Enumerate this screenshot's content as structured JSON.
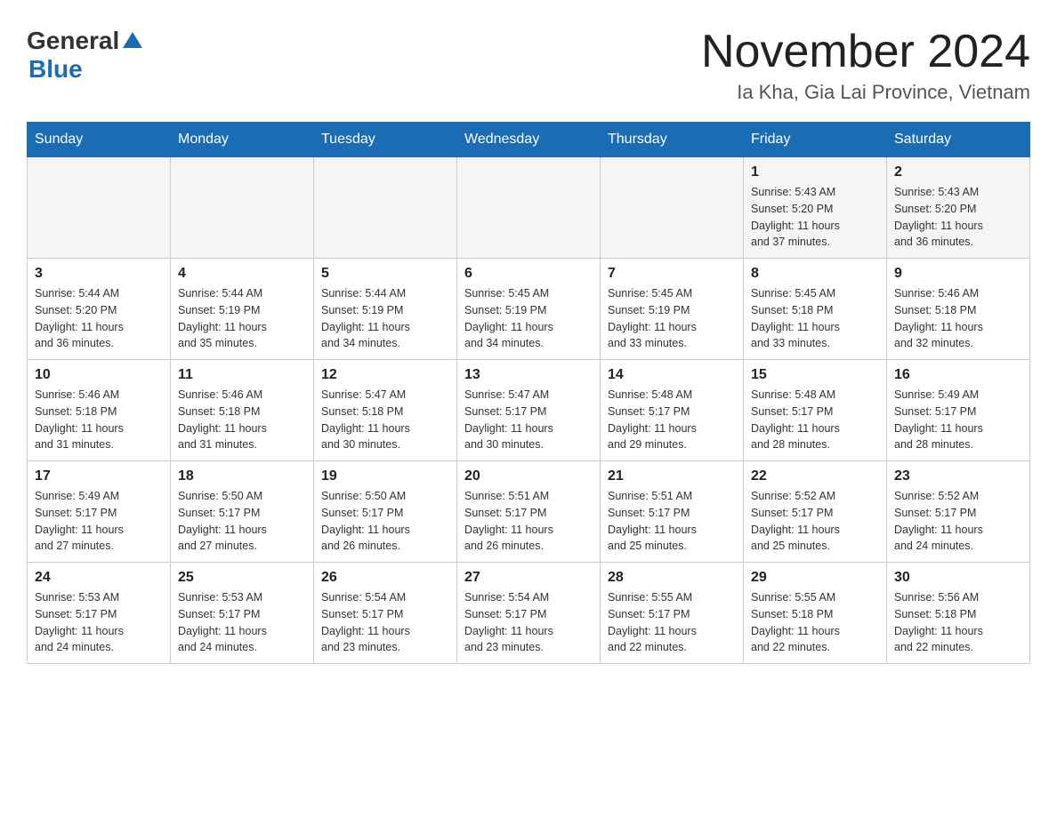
{
  "header": {
    "logo_general": "General",
    "logo_arrow": "▲",
    "logo_blue": "Blue",
    "title": "November 2024",
    "subtitle": "Ia Kha, Gia Lai Province, Vietnam"
  },
  "weekdays": [
    "Sunday",
    "Monday",
    "Tuesday",
    "Wednesday",
    "Thursday",
    "Friday",
    "Saturday"
  ],
  "weeks": [
    [
      {
        "day": "",
        "info": ""
      },
      {
        "day": "",
        "info": ""
      },
      {
        "day": "",
        "info": ""
      },
      {
        "day": "",
        "info": ""
      },
      {
        "day": "",
        "info": ""
      },
      {
        "day": "1",
        "info": "Sunrise: 5:43 AM\nSunset: 5:20 PM\nDaylight: 11 hours\nand 37 minutes."
      },
      {
        "day": "2",
        "info": "Sunrise: 5:43 AM\nSunset: 5:20 PM\nDaylight: 11 hours\nand 36 minutes."
      }
    ],
    [
      {
        "day": "3",
        "info": "Sunrise: 5:44 AM\nSunset: 5:20 PM\nDaylight: 11 hours\nand 36 minutes."
      },
      {
        "day": "4",
        "info": "Sunrise: 5:44 AM\nSunset: 5:19 PM\nDaylight: 11 hours\nand 35 minutes."
      },
      {
        "day": "5",
        "info": "Sunrise: 5:44 AM\nSunset: 5:19 PM\nDaylight: 11 hours\nand 34 minutes."
      },
      {
        "day": "6",
        "info": "Sunrise: 5:45 AM\nSunset: 5:19 PM\nDaylight: 11 hours\nand 34 minutes."
      },
      {
        "day": "7",
        "info": "Sunrise: 5:45 AM\nSunset: 5:19 PM\nDaylight: 11 hours\nand 33 minutes."
      },
      {
        "day": "8",
        "info": "Sunrise: 5:45 AM\nSunset: 5:18 PM\nDaylight: 11 hours\nand 33 minutes."
      },
      {
        "day": "9",
        "info": "Sunrise: 5:46 AM\nSunset: 5:18 PM\nDaylight: 11 hours\nand 32 minutes."
      }
    ],
    [
      {
        "day": "10",
        "info": "Sunrise: 5:46 AM\nSunset: 5:18 PM\nDaylight: 11 hours\nand 31 minutes."
      },
      {
        "day": "11",
        "info": "Sunrise: 5:46 AM\nSunset: 5:18 PM\nDaylight: 11 hours\nand 31 minutes."
      },
      {
        "day": "12",
        "info": "Sunrise: 5:47 AM\nSunset: 5:18 PM\nDaylight: 11 hours\nand 30 minutes."
      },
      {
        "day": "13",
        "info": "Sunrise: 5:47 AM\nSunset: 5:17 PM\nDaylight: 11 hours\nand 30 minutes."
      },
      {
        "day": "14",
        "info": "Sunrise: 5:48 AM\nSunset: 5:17 PM\nDaylight: 11 hours\nand 29 minutes."
      },
      {
        "day": "15",
        "info": "Sunrise: 5:48 AM\nSunset: 5:17 PM\nDaylight: 11 hours\nand 28 minutes."
      },
      {
        "day": "16",
        "info": "Sunrise: 5:49 AM\nSunset: 5:17 PM\nDaylight: 11 hours\nand 28 minutes."
      }
    ],
    [
      {
        "day": "17",
        "info": "Sunrise: 5:49 AM\nSunset: 5:17 PM\nDaylight: 11 hours\nand 27 minutes."
      },
      {
        "day": "18",
        "info": "Sunrise: 5:50 AM\nSunset: 5:17 PM\nDaylight: 11 hours\nand 27 minutes."
      },
      {
        "day": "19",
        "info": "Sunrise: 5:50 AM\nSunset: 5:17 PM\nDaylight: 11 hours\nand 26 minutes."
      },
      {
        "day": "20",
        "info": "Sunrise: 5:51 AM\nSunset: 5:17 PM\nDaylight: 11 hours\nand 26 minutes."
      },
      {
        "day": "21",
        "info": "Sunrise: 5:51 AM\nSunset: 5:17 PM\nDaylight: 11 hours\nand 25 minutes."
      },
      {
        "day": "22",
        "info": "Sunrise: 5:52 AM\nSunset: 5:17 PM\nDaylight: 11 hours\nand 25 minutes."
      },
      {
        "day": "23",
        "info": "Sunrise: 5:52 AM\nSunset: 5:17 PM\nDaylight: 11 hours\nand 24 minutes."
      }
    ],
    [
      {
        "day": "24",
        "info": "Sunrise: 5:53 AM\nSunset: 5:17 PM\nDaylight: 11 hours\nand 24 minutes."
      },
      {
        "day": "25",
        "info": "Sunrise: 5:53 AM\nSunset: 5:17 PM\nDaylight: 11 hours\nand 24 minutes."
      },
      {
        "day": "26",
        "info": "Sunrise: 5:54 AM\nSunset: 5:17 PM\nDaylight: 11 hours\nand 23 minutes."
      },
      {
        "day": "27",
        "info": "Sunrise: 5:54 AM\nSunset: 5:17 PM\nDaylight: 11 hours\nand 23 minutes."
      },
      {
        "day": "28",
        "info": "Sunrise: 5:55 AM\nSunset: 5:17 PM\nDaylight: 11 hours\nand 22 minutes."
      },
      {
        "day": "29",
        "info": "Sunrise: 5:55 AM\nSunset: 5:18 PM\nDaylight: 11 hours\nand 22 minutes."
      },
      {
        "day": "30",
        "info": "Sunrise: 5:56 AM\nSunset: 5:18 PM\nDaylight: 11 hours\nand 22 minutes."
      }
    ]
  ]
}
